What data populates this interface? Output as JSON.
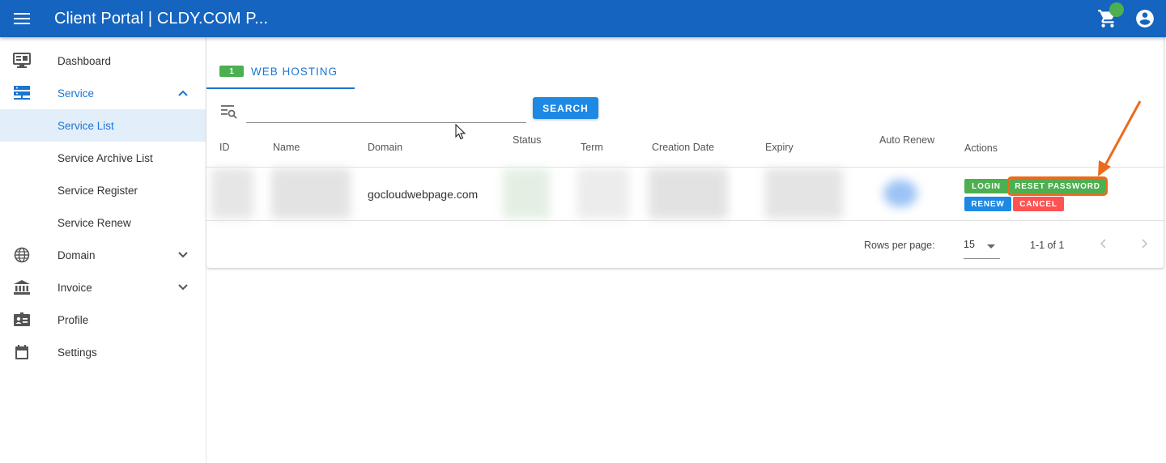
{
  "topbar": {
    "title": "Client Portal | CLDY.COM P...",
    "menu_icon": "hamburger-menu-icon",
    "cart_icon": "cart-icon",
    "account_icon": "account-circle-icon",
    "cart_status_color": "#4caf50"
  },
  "sidebar": {
    "items": [
      {
        "label": "Dashboard",
        "icon": "monitor-icon"
      },
      {
        "label": "Service",
        "icon": "server-icon",
        "expanded": true
      },
      {
        "label": "Service List",
        "selected": true
      },
      {
        "label": "Service Archive List"
      },
      {
        "label": "Service Register"
      },
      {
        "label": "Service Renew"
      },
      {
        "label": "Domain",
        "icon": "globe-icon"
      },
      {
        "label": "Invoice",
        "icon": "bank-icon"
      },
      {
        "label": "Profile",
        "icon": "id-card-icon"
      },
      {
        "label": "Settings",
        "icon": "calendar-icon"
      }
    ]
  },
  "tabs": [
    {
      "badge": "1",
      "label": "WEB HOSTING",
      "active": true
    }
  ],
  "search": {
    "value": "",
    "placeholder": "",
    "button_label": "SEARCH"
  },
  "table": {
    "headers": [
      "ID",
      "Name",
      "Domain",
      "Status",
      "Term",
      "Creation Date",
      "Expiry",
      "Auto Renew",
      "Actions"
    ],
    "rows": [
      {
        "domain": "gocloudwebpage.com",
        "actions": [
          "LOGIN",
          "RESET PASSWORD",
          "RENEW",
          "CANCEL"
        ]
      }
    ]
  },
  "pagination": {
    "rows_per_page_label": "Rows per page:",
    "rows_per_page": "15",
    "range": "1-1 of 1"
  },
  "colors": {
    "primary": "#1565c0",
    "accent": "#1976d2",
    "success": "#4caf50",
    "danger": "#ff5252",
    "annotation": "#ed6a1c"
  }
}
